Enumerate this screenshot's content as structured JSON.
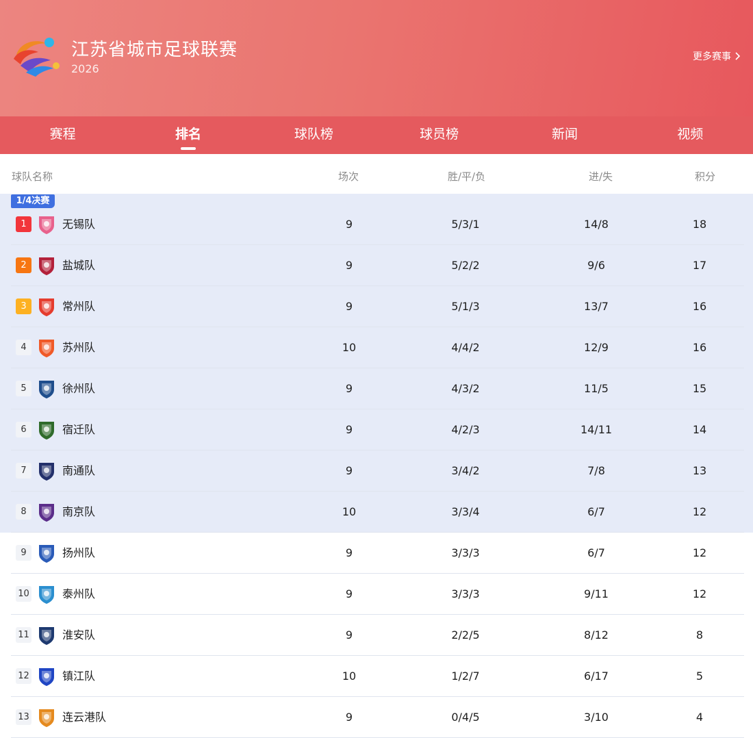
{
  "header": {
    "title": "江苏省城市足球联赛",
    "year": "2026",
    "more_label": "更多赛事"
  },
  "tabs": [
    {
      "label": "赛程",
      "active": false
    },
    {
      "label": "排名",
      "active": true
    },
    {
      "label": "球队榜",
      "active": false
    },
    {
      "label": "球员榜",
      "active": false
    },
    {
      "label": "新闻",
      "active": false
    },
    {
      "label": "视频",
      "active": false
    }
  ],
  "table": {
    "columns": {
      "team": "球队名称",
      "games": "场次",
      "wdl": "胜/平/负",
      "gfga": "进/失",
      "points": "积分"
    },
    "qualification_label": "1/4决赛",
    "rows": [
      {
        "rank": "1",
        "team": "无锡队",
        "games": "9",
        "wdl": "5/3/1",
        "gfga": "14/8",
        "points": "18",
        "crest": "wuxi-crest-icon",
        "color": "#e8618c"
      },
      {
        "rank": "2",
        "team": "盐城队",
        "games": "9",
        "wdl": "5/2/2",
        "gfga": "9/6",
        "points": "17",
        "crest": "yancheng-crest-icon",
        "color": "#b3213a"
      },
      {
        "rank": "3",
        "team": "常州队",
        "games": "9",
        "wdl": "5/1/3",
        "gfga": "13/7",
        "points": "16",
        "crest": "changzhou-crest-icon",
        "color": "#e53c2e"
      },
      {
        "rank": "4",
        "team": "苏州队",
        "games": "10",
        "wdl": "4/4/2",
        "gfga": "12/9",
        "points": "16",
        "crest": "suzhou-crest-icon",
        "color": "#f05a28"
      },
      {
        "rank": "5",
        "team": "徐州队",
        "games": "9",
        "wdl": "4/3/2",
        "gfga": "11/5",
        "points": "15",
        "crest": "xuzhou-crest-icon",
        "color": "#1f4e8c"
      },
      {
        "rank": "6",
        "team": "宿迁队",
        "games": "9",
        "wdl": "4/2/3",
        "gfga": "14/11",
        "points": "14",
        "crest": "suqian-crest-icon",
        "color": "#2f6b2b"
      },
      {
        "rank": "7",
        "team": "南通队",
        "games": "9",
        "wdl": "3/4/2",
        "gfga": "7/8",
        "points": "13",
        "crest": "nantong-crest-icon",
        "color": "#23306b"
      },
      {
        "rank": "8",
        "team": "南京队",
        "games": "10",
        "wdl": "3/3/4",
        "gfga": "6/7",
        "points": "12",
        "crest": "nanjing-crest-icon",
        "color": "#5b2d8a"
      },
      {
        "rank": "9",
        "team": "扬州队",
        "games": "9",
        "wdl": "3/3/3",
        "gfga": "6/7",
        "points": "12",
        "crest": "yangzhou-crest-icon",
        "color": "#2a5bb8"
      },
      {
        "rank": "10",
        "team": "泰州队",
        "games": "9",
        "wdl": "3/3/3",
        "gfga": "9/11",
        "points": "12",
        "crest": "taizhou-crest-icon",
        "color": "#2b8fcf"
      },
      {
        "rank": "11",
        "team": "淮安队",
        "games": "9",
        "wdl": "2/2/5",
        "gfga": "8/12",
        "points": "8",
        "crest": "huaian-crest-icon",
        "color": "#1e3a70"
      },
      {
        "rank": "12",
        "team": "镇江队",
        "games": "10",
        "wdl": "1/2/7",
        "gfga": "6/17",
        "points": "5",
        "crest": "zhenjiang-crest-icon",
        "color": "#2046c4"
      },
      {
        "rank": "13",
        "team": "连云港队",
        "games": "9",
        "wdl": "0/4/5",
        "gfga": "3/10",
        "points": "4",
        "crest": "lianyungang-crest-icon",
        "color": "#e58a1e"
      }
    ]
  },
  "colors": {
    "header_start": "#ec8580",
    "header_end": "#e7585d",
    "tab_bar": "#e55a5e",
    "qualification_bg": "#e6ebf8",
    "qualification_badge": "#3f6fe0",
    "rank1": "#f2353b",
    "rank2": "#f77612",
    "rank3": "#fdb122"
  }
}
